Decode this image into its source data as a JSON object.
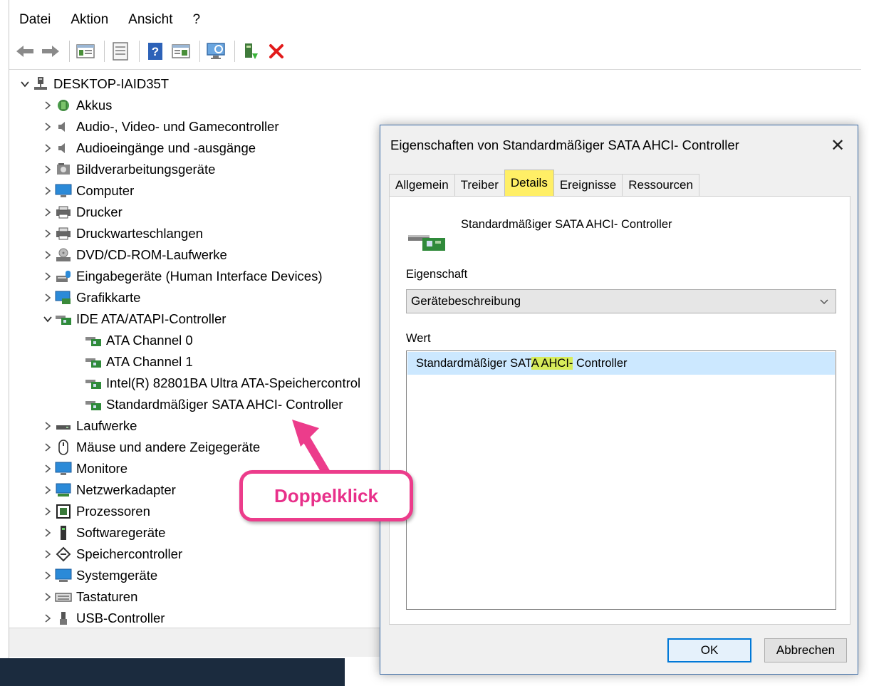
{
  "menubar": {
    "items": [
      "Datei",
      "Aktion",
      "Ansicht",
      "?"
    ]
  },
  "toolbar": {
    "buttons": [
      "back-arrow-icon",
      "forward-arrow-icon",
      "console-tree-icon",
      "properties-icon",
      "help-icon",
      "action-pane-icon",
      "scan-hardware-icon",
      "update-driver-icon",
      "uninstall-icon"
    ]
  },
  "tree": {
    "root": "DESKTOP-IAID35T",
    "categories": [
      "Akkus",
      "Audio-, Video- und Gamecontroller",
      "Audioeingänge und -ausgänge",
      "Bildverarbeitungsgeräte",
      "Computer",
      "Drucker",
      "Druckwarteschlangen",
      "DVD/CD-ROM-Laufwerke",
      "Eingabegeräte (Human Interface Devices)",
      "Grafikkarte",
      "IDE ATA/ATAPI-Controller",
      "Laufwerke",
      "Mäuse und andere Zeigegeräte",
      "Monitore",
      "Netzwerkadapter",
      "Prozessoren",
      "Softwaregeräte",
      "Speichercontroller",
      "Systemgeräte",
      "Tastaturen",
      "USB-Controller"
    ],
    "ide_children": [
      "ATA Channel 0",
      "ATA Channel 1",
      "Intel(R) 82801BA Ultra ATA-Speichercontrol",
      "Standardmäßiger SATA AHCI- Controller"
    ]
  },
  "dialog": {
    "title": "Eigenschaften von Standardmäßiger SATA AHCI- Controller",
    "close": "✕",
    "tabs": [
      "Allgemein",
      "Treiber",
      "Details",
      "Ereignisse",
      "Ressourcen"
    ],
    "active_tab": "Details",
    "device_name": "Standardmäßiger SATA AHCI- Controller",
    "property_label": "Eigenschaft",
    "property_value": "Gerätebeschreibung",
    "value_label": "Wert",
    "value_before": "Standardmäßiger SAT",
    "value_highlight": "A AHCI-",
    "value_after": " Controller",
    "ok": "OK",
    "cancel": "Abbrechen"
  },
  "annotation": {
    "text": "Doppelklick",
    "color": "#ec3c8b"
  },
  "colors": {
    "highlight": "#ffef66",
    "selection": "#cce8ff",
    "accent": "#0078d7"
  }
}
